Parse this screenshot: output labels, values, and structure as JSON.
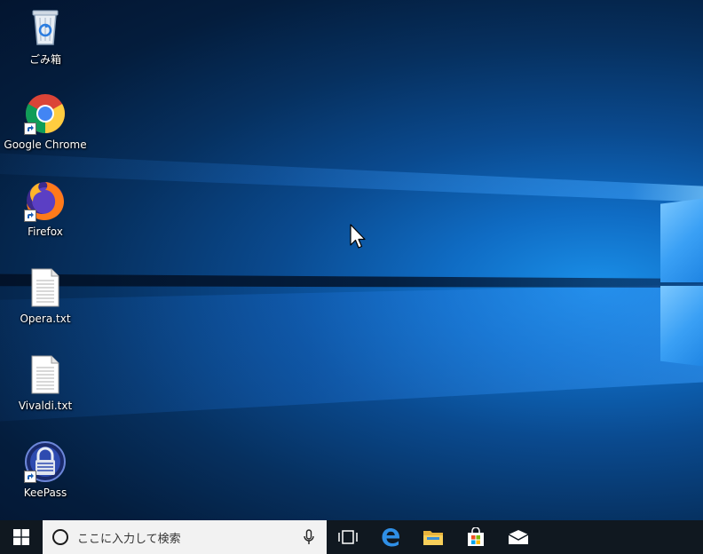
{
  "desktop": {
    "icons": [
      {
        "label": "ごみ箱",
        "icon": "recycle-bin-icon",
        "shortcut": false
      },
      {
        "label": "Google Chrome",
        "icon": "chrome-icon",
        "shortcut": true
      },
      {
        "label": "Firefox",
        "icon": "firefox-icon",
        "shortcut": true
      },
      {
        "label": "Opera.txt",
        "icon": "text-file-icon",
        "shortcut": false
      },
      {
        "label": "Vivaldi.txt",
        "icon": "text-file-icon",
        "shortcut": false
      },
      {
        "label": "KeePass",
        "icon": "keepass-icon",
        "shortcut": true
      }
    ]
  },
  "taskbar": {
    "search": {
      "placeholder": "ここに入力して検索"
    },
    "pinned": [
      "task-view-icon",
      "edge-icon",
      "file-explorer-icon",
      "store-icon",
      "mail-icon"
    ]
  },
  "colors": {
    "taskbar": "#101820",
    "accent": "#0078d7"
  }
}
